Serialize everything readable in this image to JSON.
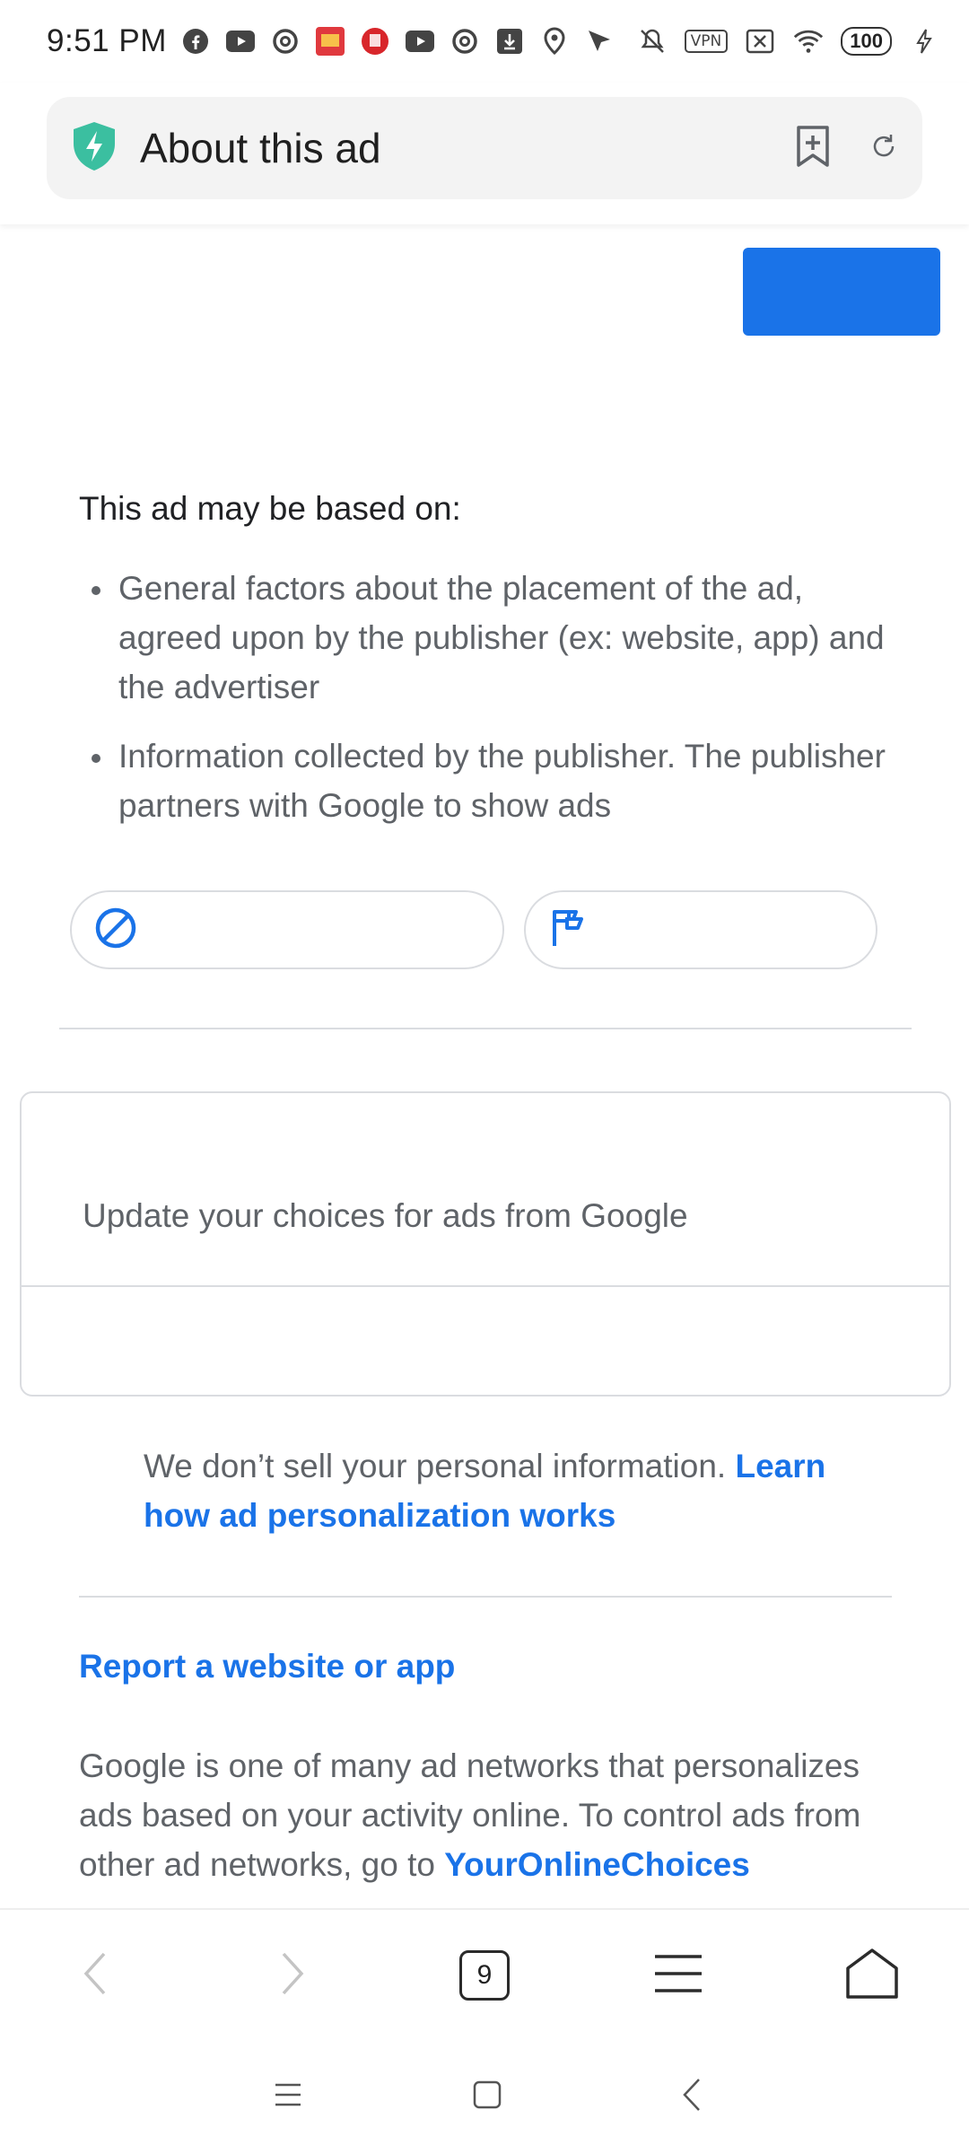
{
  "status_bar": {
    "time": "9:51 PM",
    "left_icons": [
      "facebook-icon",
      "youtube-icon",
      "at-sign-icon",
      "app-red-icon",
      "app-red-seal-icon",
      "youtube-icon",
      "at-sign-icon",
      "download-icon",
      "location-pin-icon",
      "send-arrow-icon"
    ],
    "right_icons": [
      "bell-off-icon",
      "vpn-icon",
      "sim-off-icon",
      "wifi-icon",
      "battery-icon",
      "charging-icon"
    ],
    "vpn_label": "VPN",
    "battery_level": "100"
  },
  "url_bar": {
    "title": "About this ad",
    "shield_color": "#3bbfa0"
  },
  "content": {
    "based_on_heading": "This ad may be based on:",
    "bullets": [
      "General factors about the placement of the ad, agreed upon by the publisher (ex: website, app) and the advertiser",
      "Information collected by the publisher. The publisher partners with Google to show ads"
    ],
    "choices_label": "Update your choices for ads from Google",
    "sell_text": "We don’t sell your personal information.",
    "sell_link": "Learn how ad personalization works",
    "report_link": "Report a website or app",
    "networks_text": "Google is one of many ad networks that personalizes ads based on your activity online. To control ads from other ad networks, go to",
    "networks_link": "YourOnlineChoices"
  },
  "bottom_toolbar": {
    "tab_count": "9"
  },
  "colors": {
    "accent_blue": "#1a73e8",
    "divider": "#dadce0",
    "body_text": "#5f6368"
  }
}
